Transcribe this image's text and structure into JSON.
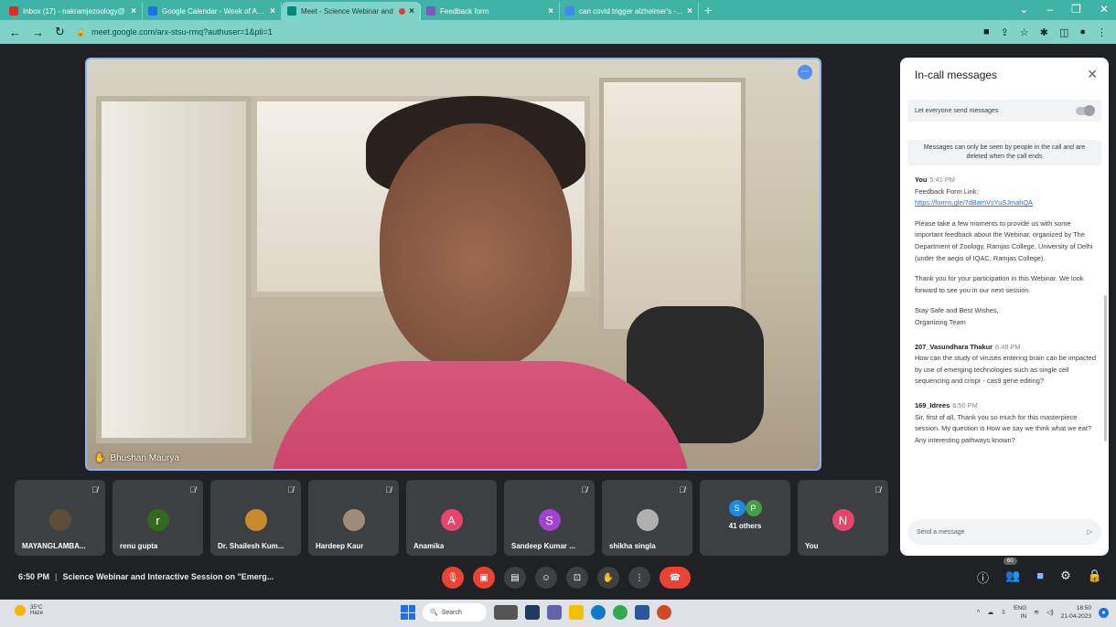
{
  "browser": {
    "tabs": [
      {
        "title": "Inbox (17) - nakramjezoology@",
        "color": "#d93025",
        "active": false
      },
      {
        "title": "Google Calendar - Week of April",
        "color": "#1a73e8",
        "active": false
      },
      {
        "title": "Meet - Science Webinar and",
        "color": "#00897b",
        "active": true
      },
      {
        "title": "Feedback form",
        "color": "#7e57c2",
        "active": false
      },
      {
        "title": "can covid trigger alzheimer's - G",
        "color": "#4285f4",
        "active": false
      }
    ],
    "url": "meet.google.com/arx-stsu-rmq?authuser=1&pli=1"
  },
  "video": {
    "presenter_name": "Bhushan Maurya"
  },
  "participants": [
    {
      "name": "MAYANGLAMBA...",
      "initial": "",
      "color": "#5d4e3a",
      "muted": true
    },
    {
      "name": "renu gupta",
      "initial": "r",
      "color": "#33691e",
      "muted": true
    },
    {
      "name": "Dr. Shailesh Kum...",
      "initial": "",
      "color": "#c88a2a",
      "muted": true
    },
    {
      "name": "Hardeep Kaur",
      "initial": "",
      "color": "#9e8b7a",
      "muted": true
    },
    {
      "name": "Anamika",
      "initial": "A",
      "color": "#e8456c",
      "muted": false
    },
    {
      "name": "Sandeep Kumar ...",
      "initial": "S",
      "color": "#a142d0",
      "muted": true
    },
    {
      "name": "shikha singla",
      "initial": "",
      "color": "#b0b0b0",
      "muted": true
    }
  ],
  "others_tile": {
    "label": "41 others",
    "initials": [
      "S",
      "P"
    ],
    "colors": [
      "#1e88e5",
      "#43a047"
    ]
  },
  "self_tile": {
    "name": "You",
    "initial": "N",
    "color": "#e8456c"
  },
  "meeting": {
    "time": "6:50 PM",
    "title": "Science Webinar and Interactive Session on \"Emerg..."
  },
  "people_count": "60",
  "chat": {
    "header": "In-call messages",
    "allow_label": "Let everyone send messages",
    "notice": "Messages can only be seen by people in the call and are deleted when the call ends",
    "messages": [
      {
        "sender": "You",
        "time": "5:41 PM",
        "line1": "Feedback Form Link:",
        "link": "https://forms.gle/7dBamVsYuSJmahQA",
        "para1": "Please take a few moments to provide us with some important feedback about the Webinar, organized by The Department of Zoology, Ramjas College, University of Delhi (under the aegis of IQAC, Ramjas College).",
        "para2": "Thank you for your participation in this Webinar. We look forward to see you in our next session.",
        "para3": "Stay Safe and Best Wishes,",
        "para4": "Organizing Team"
      },
      {
        "sender": "207_Vasundhara Thakur",
        "time": "6:48 PM",
        "text": "How can the study of viruses entering brain can be impacted by use of emerging technologies such as single cell sequencing and crispr - cas9 gene editing?"
      },
      {
        "sender": "169_Idrees",
        "time": "6:50 PM",
        "text": "Sir, first of all, Thank you so much for this masterpiece session. My question is How we say we think what we eat? Any interesting pathways known?"
      }
    ],
    "input_placeholder": "Send a message"
  },
  "taskbar": {
    "temp": "35°C",
    "weather": "Haze",
    "search": "Search",
    "lang1": "ENG",
    "lang2": "IN",
    "time": "18:50",
    "date": "21-04-2023"
  }
}
